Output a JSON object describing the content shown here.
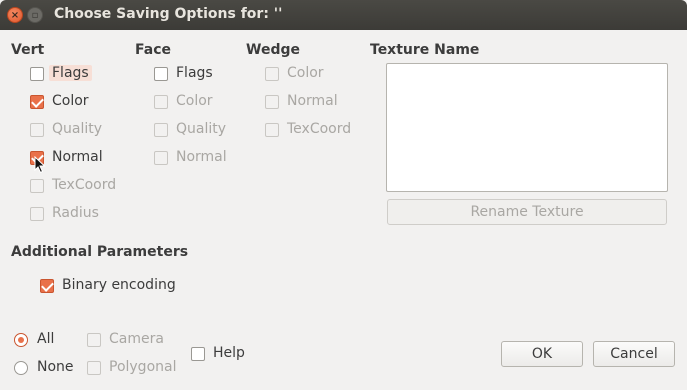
{
  "window": {
    "title": "Choose Saving Options for: ''",
    "close_glyph": "×",
    "max_glyph": "▫"
  },
  "vert": {
    "title": "Vert",
    "items": [
      {
        "label": "Flags",
        "checked": false,
        "enabled": true
      },
      {
        "label": "Color",
        "checked": true,
        "enabled": true
      },
      {
        "label": "Quality",
        "checked": false,
        "enabled": false
      },
      {
        "label": "Normal",
        "checked": true,
        "enabled": true
      },
      {
        "label": "TexCoord",
        "checked": false,
        "enabled": false
      },
      {
        "label": "Radius",
        "checked": false,
        "enabled": false
      }
    ]
  },
  "face": {
    "title": "Face",
    "items": [
      {
        "label": "Flags",
        "checked": false,
        "enabled": true
      },
      {
        "label": "Color",
        "checked": false,
        "enabled": false
      },
      {
        "label": "Quality",
        "checked": false,
        "enabled": false
      },
      {
        "label": "Normal",
        "checked": false,
        "enabled": false
      }
    ]
  },
  "wedge": {
    "title": "Wedge",
    "items": [
      {
        "label": "Color",
        "checked": false,
        "enabled": false
      },
      {
        "label": "Normal",
        "checked": false,
        "enabled": false
      },
      {
        "label": "TexCoord",
        "checked": false,
        "enabled": false
      }
    ]
  },
  "texture": {
    "title": "Texture Name",
    "rename_label": "Rename Texture"
  },
  "additional": {
    "title": "Additional Parameters",
    "binary_label": "Binary encoding",
    "binary_checked": true
  },
  "footer": {
    "all_label": "All",
    "none_label": "None",
    "camera_label": "Camera",
    "polygonal_label": "Polygonal",
    "help_label": "Help",
    "ok_label": "OK",
    "cancel_label": "Cancel"
  },
  "colors": {
    "accent": "#e9714a",
    "titlebar": "#3c3b37",
    "background": "#f2f1f0"
  }
}
